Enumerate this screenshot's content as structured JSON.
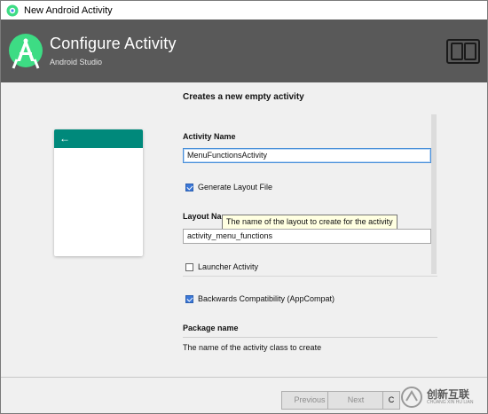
{
  "window": {
    "title": "New Android Activity"
  },
  "banner": {
    "title": "Configure Activity",
    "subtitle": "Android Studio"
  },
  "form": {
    "section_title": "Creates a new empty activity",
    "activity_name_label": "Activity Name",
    "activity_name_value": "MenuFunctionsActivity",
    "generate_layout_label": "Generate Layout File",
    "generate_layout_checked": true,
    "layout_name_label": "Layout Na",
    "layout_name_value": "activity_menu_functions",
    "layout_tooltip": "The name of the layout to create for the activity",
    "launcher_activity_label": "Launcher Activity",
    "launcher_activity_checked": false,
    "backwards_compat_label": "Backwards Compatibility (AppCompat)",
    "backwards_compat_checked": true,
    "package_name_label": "Package name",
    "helper_text": "The name of the activity class to create"
  },
  "preview": {
    "appbar_color": "#00897b"
  },
  "footer": {
    "previous_label": "Previous",
    "next_label": "Next",
    "cancel_label": "C"
  },
  "watermark": {
    "text": "创新互联",
    "sub": "CHUANG XIN HU LIAN"
  },
  "colors": {
    "banner_bg": "#595959",
    "accent": "#3c78d8"
  }
}
